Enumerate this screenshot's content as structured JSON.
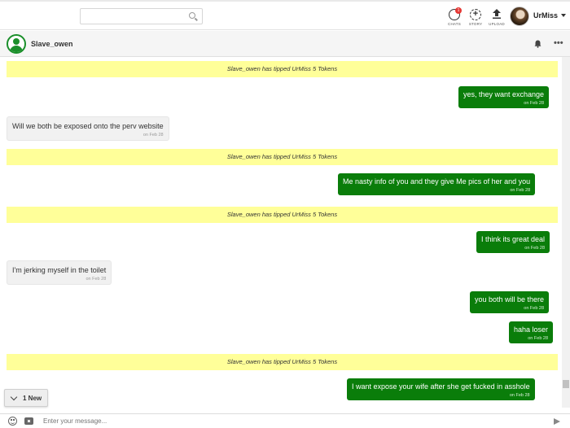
{
  "topbar": {
    "search_placeholder": "",
    "nav": [
      {
        "label": "CHATS",
        "icon": "chats-icon",
        "badge": "1"
      },
      {
        "label": "STORY",
        "icon": "story-add-icon"
      },
      {
        "label": "UPLOAD",
        "icon": "upload-icon"
      }
    ],
    "user": {
      "name": "UrMiss"
    }
  },
  "chat": {
    "peer_name": "Slave_owen",
    "messages": [
      {
        "kind": "tip",
        "text": "Slave_owen has tipped UrMiss 5 Tokens"
      },
      {
        "kind": "out",
        "text": "yes, they want exchange",
        "date": "on Feb 28"
      },
      {
        "kind": "in",
        "text": "Will we both be exposed onto the perv website",
        "date": "on Feb 28"
      },
      {
        "kind": "tip",
        "text": "Slave_owen has tipped UrMiss 5 Tokens"
      },
      {
        "kind": "out",
        "text": "Me nasty info of you and they give Me pics of her and you",
        "date": "on Feb 28"
      },
      {
        "kind": "tip",
        "text": "Slave_owen has tipped UrMiss 5 Tokens"
      },
      {
        "kind": "out",
        "text": "I think its great deal",
        "date": "on Feb 28"
      },
      {
        "kind": "in",
        "text": "I'm jerking myself in the toilet",
        "date": "on Feb 28"
      },
      {
        "kind": "out",
        "text": "you both will be there",
        "date": "on Feb 28"
      },
      {
        "kind": "out",
        "text": "haha loser",
        "date": "on Feb 28"
      },
      {
        "kind": "tip",
        "text": "Slave_owen has tipped UrMiss 5 Tokens"
      },
      {
        "kind": "out",
        "text": "I want expose your wife after she get fucked in asshole",
        "date": "on Feb 28"
      }
    ],
    "new_indicator": "1 New",
    "composer_placeholder": "Enter your message..."
  },
  "colors": {
    "outgoing_bubble": "#0a7d0a",
    "incoming_bubble": "#f1f1f1",
    "tip_banner": "#ffff99",
    "badge": "#e53935"
  }
}
